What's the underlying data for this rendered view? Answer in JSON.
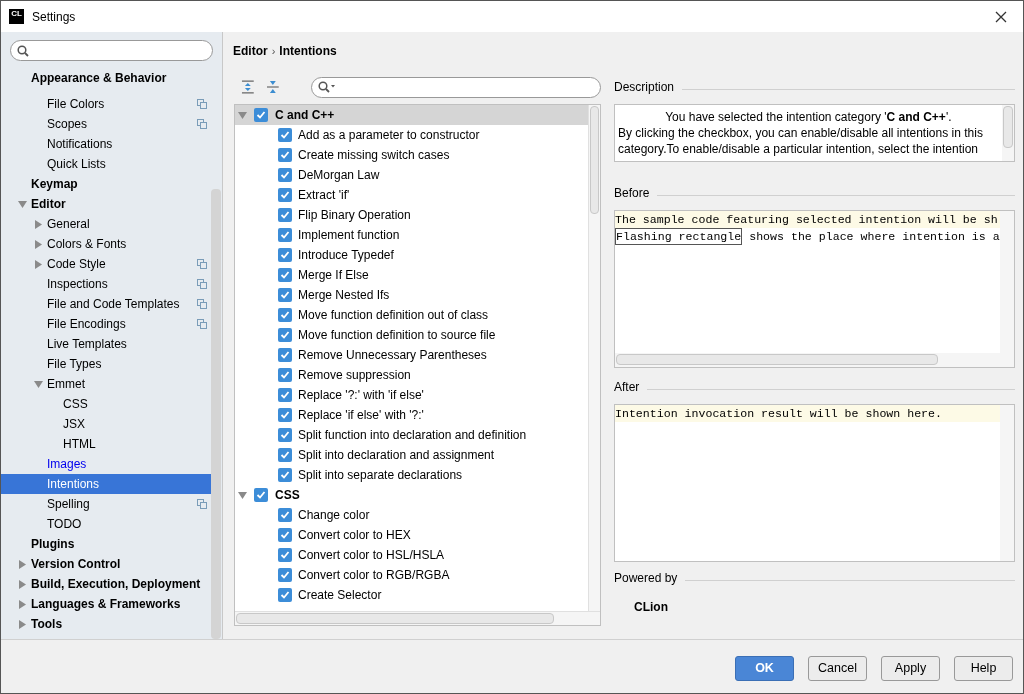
{
  "window": {
    "title": "Settings",
    "app_badge": "CL"
  },
  "sidebar": {
    "items": [
      {
        "label": "Appearance & Behavior",
        "selected": false,
        "modified": false,
        "per_project": false,
        "children": [
          {
            "label": "File Colors",
            "selected": false,
            "modified": false,
            "per_project": true
          },
          {
            "label": "Scopes",
            "selected": false,
            "modified": false,
            "per_project": true
          },
          {
            "label": "Notifications",
            "selected": false,
            "modified": false,
            "per_project": false
          },
          {
            "label": "Quick Lists",
            "selected": false,
            "modified": false,
            "per_project": false
          }
        ]
      },
      {
        "label": "Keymap",
        "selected": false,
        "modified": false,
        "per_project": false
      },
      {
        "label": "Editor",
        "selected": false,
        "modified": false,
        "per_project": false,
        "expanded": true,
        "children": [
          {
            "label": "General",
            "selected": false,
            "modified": false,
            "per_project": false,
            "expanded": false
          },
          {
            "label": "Colors & Fonts",
            "selected": false,
            "modified": false,
            "per_project": false,
            "expanded": false
          },
          {
            "label": "Code Style",
            "selected": false,
            "modified": false,
            "per_project": true,
            "expanded": false
          },
          {
            "label": "Inspections",
            "selected": false,
            "modified": false,
            "per_project": true
          },
          {
            "label": "File and Code Templates",
            "selected": false,
            "modified": false,
            "per_project": true
          },
          {
            "label": "File Encodings",
            "selected": false,
            "modified": false,
            "per_project": true
          },
          {
            "label": "Live Templates",
            "selected": false,
            "modified": false,
            "per_project": false
          },
          {
            "label": "File Types",
            "selected": false,
            "modified": false,
            "per_project": false
          },
          {
            "label": "Emmet",
            "selected": false,
            "modified": false,
            "per_project": false,
            "expanded": true,
            "children": [
              {
                "label": "CSS",
                "selected": false,
                "modified": false,
                "per_project": false
              },
              {
                "label": "JSX",
                "selected": false,
                "modified": false,
                "per_project": false
              },
              {
                "label": "HTML",
                "selected": false,
                "modified": false,
                "per_project": false
              }
            ]
          },
          {
            "label": "Images",
            "selected": false,
            "modified": true,
            "per_project": false
          },
          {
            "label": "Intentions",
            "selected": true,
            "modified": false,
            "per_project": false
          },
          {
            "label": "Spelling",
            "selected": false,
            "modified": false,
            "per_project": true
          },
          {
            "label": "TODO",
            "selected": false,
            "modified": false,
            "per_project": false
          }
        ]
      },
      {
        "label": "Plugins",
        "selected": false,
        "modified": false,
        "per_project": false
      },
      {
        "label": "Version Control",
        "selected": false,
        "modified": false,
        "per_project": false,
        "expanded": false
      },
      {
        "label": "Build, Execution, Deployment",
        "selected": false,
        "modified": false,
        "per_project": false,
        "expanded": false
      },
      {
        "label": "Languages & Frameworks",
        "selected": false,
        "modified": false,
        "per_project": false,
        "expanded": false
      },
      {
        "label": "Tools",
        "selected": false,
        "modified": false,
        "per_project": false,
        "expanded": false
      }
    ]
  },
  "breadcrumb": {
    "items": [
      "Editor",
      "Intentions"
    ],
    "separator": "›"
  },
  "intentions": [
    {
      "label": "C and C++",
      "checked": true,
      "expanded": true,
      "selected": true,
      "children": [
        {
          "label": "Add as a parameter to constructor",
          "checked": true
        },
        {
          "label": "Create missing switch cases",
          "checked": true
        },
        {
          "label": "DeMorgan Law",
          "checked": true
        },
        {
          "label": "Extract 'if'",
          "checked": true
        },
        {
          "label": "Flip Binary Operation",
          "checked": true
        },
        {
          "label": "Implement function",
          "checked": true
        },
        {
          "label": "Introduce Typedef",
          "checked": true
        },
        {
          "label": "Merge If Else",
          "checked": true
        },
        {
          "label": "Merge Nested Ifs",
          "checked": true
        },
        {
          "label": "Move function definition out of class",
          "checked": true
        },
        {
          "label": "Move function definition to source file",
          "checked": true
        },
        {
          "label": "Remove Unnecessary Parentheses",
          "checked": true
        },
        {
          "label": "Remove suppression",
          "checked": true
        },
        {
          "label": "Replace '?:' with 'if else'",
          "checked": true
        },
        {
          "label": "Replace 'if else' with '?:'",
          "checked": true
        },
        {
          "label": "Split function into declaration and definition",
          "checked": true
        },
        {
          "label": "Split into declaration and assignment",
          "checked": true
        },
        {
          "label": "Split into separate declarations",
          "checked": true
        }
      ]
    },
    {
      "label": "CSS",
      "checked": true,
      "expanded": true,
      "selected": false,
      "children": [
        {
          "label": "Change color",
          "checked": true
        },
        {
          "label": "Convert color to HEX",
          "checked": true
        },
        {
          "label": "Convert color to HSL/HSLA",
          "checked": true
        },
        {
          "label": "Convert color to RGB/RGBA",
          "checked": true
        },
        {
          "label": "Create Selector",
          "checked": true
        }
      ]
    }
  ],
  "description": {
    "label": "Description",
    "heading": "You have selected the intention category '**C and C++**'.",
    "text": "By clicking the checkbox, you can enable/disable all intentions in this category.To enable/disable a particular intention, select the intention"
  },
  "before": {
    "label": "Before",
    "lines": [
      {
        "text": "The sample code featuring selected intention will be sh"
      },
      {
        "highlight": "Flashing rectangle",
        "text": " shows the place where intention is a"
      }
    ]
  },
  "after": {
    "label": "After",
    "lines": [
      "Intention invocation result will be shown here."
    ]
  },
  "powered_by": {
    "label": "Powered by",
    "name": "CLion"
  },
  "buttons": [
    {
      "label": "OK",
      "primary": true
    },
    {
      "label": "Cancel",
      "primary": false
    },
    {
      "label": "Apply",
      "primary": false
    },
    {
      "label": "Help",
      "primary": false
    }
  ]
}
